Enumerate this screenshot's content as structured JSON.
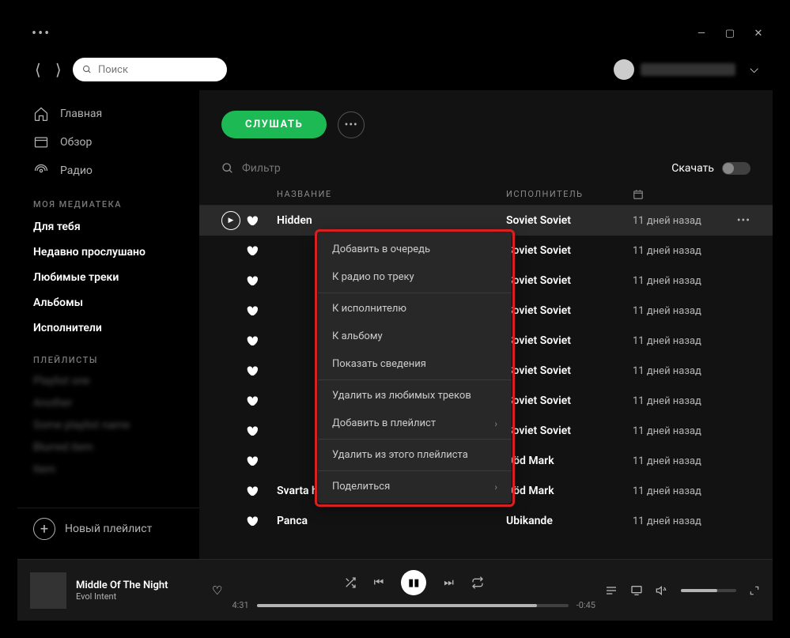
{
  "window": {
    "minimize": "—",
    "maximize": "▢",
    "close": "✕"
  },
  "topbar": {
    "search_placeholder": "Поиск"
  },
  "nav": {
    "home": "Главная",
    "browse": "Обзор",
    "radio": "Радио"
  },
  "library": {
    "header": "МОЯ МЕДИАТЕКА",
    "items": [
      "Для тебя",
      "Недавно прослушано",
      "Любимые треки",
      "Альбомы",
      "Исполнители"
    ]
  },
  "playlists": {
    "header": "ПЛЕЙЛИСТЫ",
    "new": "Новый плейлист"
  },
  "content": {
    "listen": "СЛУШАТЬ",
    "filter_placeholder": "Фильтр",
    "download": "Скачать",
    "col_title": "НАЗВАНИЕ",
    "col_artist": "ИСПОЛНИТЕЛЬ"
  },
  "tracks": [
    {
      "name": "Hidden",
      "artist": "Soviet Soviet",
      "date": "11 дней назад"
    },
    {
      "name": "",
      "artist": "Soviet Soviet",
      "date": "11 дней назад"
    },
    {
      "name": "",
      "artist": "Soviet Soviet",
      "date": "11 дней назад"
    },
    {
      "name": "",
      "artist": "Soviet Soviet",
      "date": "11 дней назад"
    },
    {
      "name": "",
      "artist": "Soviet Soviet",
      "date": "11 дней назад"
    },
    {
      "name": "",
      "artist": "Soviet Soviet",
      "date": "11 дней назад"
    },
    {
      "name": "",
      "artist": "Soviet Soviet",
      "date": "11 дней назад"
    },
    {
      "name": "",
      "artist": "Soviet Soviet",
      "date": "11 дней назад"
    },
    {
      "name": "",
      "artist": "Död Mark",
      "date": "11 дней назад"
    },
    {
      "name": "Svarta havet",
      "artist": "Död Mark",
      "date": "11 дней назад"
    },
    {
      "name": "Panca",
      "artist": "Ubikande",
      "date": "11 дней назад"
    }
  ],
  "context_menu": {
    "add_queue": "Добавить в очередь",
    "track_radio": "К радио по треку",
    "to_artist": "К исполнителю",
    "to_album": "К альбому",
    "show_info": "Показать сведения",
    "remove_liked": "Удалить из любимых треков",
    "add_playlist": "Добавить в плейлист",
    "remove_playlist": "Удалить из этого плейлиста",
    "share": "Поделиться"
  },
  "player": {
    "title": "Middle Of The Night",
    "artist": "Evol Intent",
    "elapsed": "4:31",
    "remaining": "-0:45"
  }
}
